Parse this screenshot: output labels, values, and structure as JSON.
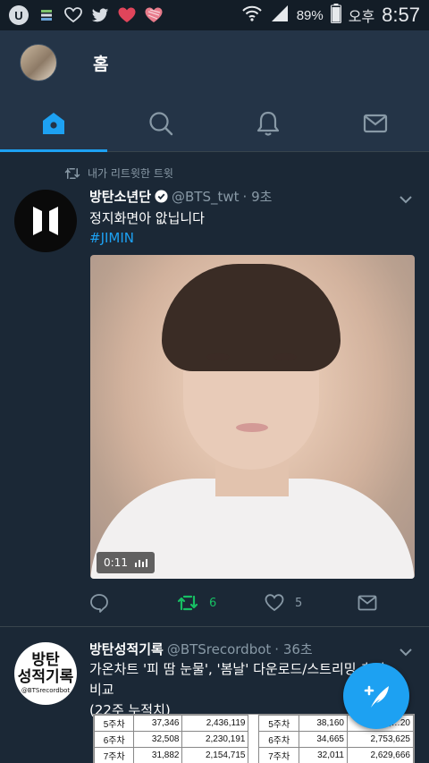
{
  "status_bar": {
    "battery_percent": "89%",
    "ampm": "오후",
    "time": "8:57",
    "left_icons": [
      "u-plus-app-icon",
      "flag-icon",
      "heart-outline-icon",
      "twitter-bird-icon",
      "heart-icon",
      "heart-patterned-icon"
    ],
    "right_icons": [
      "wifi-icon",
      "signal-icon",
      "battery-icon"
    ]
  },
  "header": {
    "title": "홈"
  },
  "tabs": [
    {
      "name": "home",
      "active": true
    },
    {
      "name": "search",
      "active": false
    },
    {
      "name": "notifications",
      "active": false
    },
    {
      "name": "messages",
      "active": false
    }
  ],
  "tweets": [
    {
      "retweet_label": "내가 리트윗한 트윗",
      "name": "방탄소년단",
      "handle": "@BTS_twt",
      "time": "· 9초",
      "verified": true,
      "text": "정지화면아 앖닙니다",
      "hashtag": "#JIMIN",
      "media": {
        "duration": "0:11",
        "type": "video"
      },
      "reply_count": "",
      "retweet_count": "6",
      "like_count": "5",
      "retweeted": true
    },
    {
      "name": "방탄성적기록",
      "handle": "@BTSrecordbot",
      "time": "· 36초",
      "avatar_line1": "방탄",
      "avatar_line2": "성적기록",
      "avatar_line3": "@BTSrecordbot",
      "text_line1": "가온차트 '피 땀 눈물', '봄날' 다운로드/스트리밍 추이",
      "text_line2": "비교",
      "text_line3": "(22주 누적치)",
      "table_rows": [
        [
          "5주차",
          "37,346",
          "2,436,119",
          "5주차",
          "38,160",
          "2,…20"
        ],
        [
          "6주차",
          "32,508",
          "2,230,191",
          "6주차",
          "34,665",
          "2,753,625"
        ],
        [
          "7주차",
          "31,882",
          "2,154,715",
          "7주차",
          "32,011",
          "2,629,666"
        ]
      ]
    }
  ],
  "colors": {
    "background": "#1b2836",
    "header": "#243447",
    "accent": "#1da1f2",
    "retweet_green": "#17bf63",
    "muted": "#8899a6"
  },
  "fab": {
    "icon": "compose-feather-icon"
  }
}
